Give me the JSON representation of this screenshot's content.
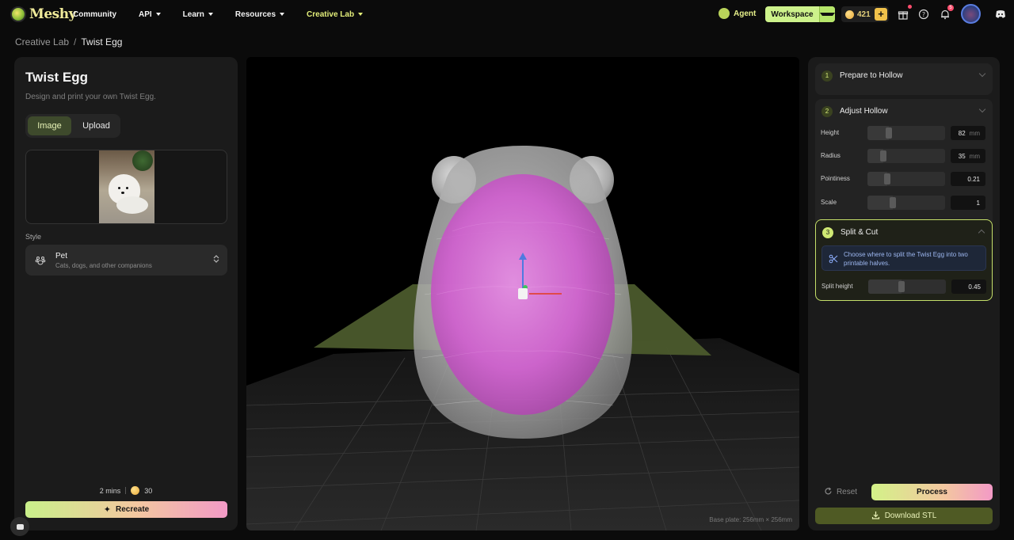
{
  "app": {
    "logo_text": "Meshy"
  },
  "nav": {
    "items": [
      {
        "label": "Community",
        "has_dropdown": false,
        "active": false
      },
      {
        "label": "API",
        "has_dropdown": true,
        "active": false
      },
      {
        "label": "Learn",
        "has_dropdown": true,
        "active": false
      },
      {
        "label": "Resources",
        "has_dropdown": true,
        "active": false
      },
      {
        "label": "Creative Lab",
        "has_dropdown": true,
        "active": true
      }
    ],
    "agent_label": "Agent",
    "workspace_label": "Workspace",
    "credits": "421",
    "notification_count": "5"
  },
  "breadcrumb": {
    "parent": "Creative Lab",
    "separator": "/",
    "current": "Twist Egg"
  },
  "left_panel": {
    "title": "Twist Egg",
    "subtitle": "Design and print your own Twist Egg.",
    "tabs": [
      {
        "label": "Image",
        "active": true
      },
      {
        "label": "Upload",
        "active": false
      }
    ],
    "style_label": "Style",
    "style_value": "Pet",
    "style_description": "Cats, dogs, and other companions",
    "time_estimate": "2 mins",
    "cost": "30",
    "recreate_label": "Recreate"
  },
  "viewport": {
    "plate_note": "Base plate: 256mm × 256mm"
  },
  "right_panel": {
    "steps": [
      {
        "number": "1",
        "title": "Prepare to Hollow"
      },
      {
        "number": "2",
        "title": "Adjust Hollow"
      },
      {
        "number": "3",
        "title": "Split & Cut"
      }
    ],
    "hollow_params": [
      {
        "label": "Height",
        "value": "82",
        "unit": "mm",
        "fraction": 0.28
      },
      {
        "label": "Radius",
        "value": "35",
        "unit": "mm",
        "fraction": 0.2
      },
      {
        "label": "Pointiness",
        "value": "0.21",
        "unit": "",
        "fraction": 0.25
      },
      {
        "label": "Scale",
        "value": "1",
        "unit": "",
        "fraction": 0.33
      }
    ],
    "split_info": "Choose where to split the Twist Egg into two printable halves.",
    "split_param": {
      "label": "Split height",
      "value": "0.45",
      "fraction": 0.43
    },
    "reset_label": "Reset",
    "process_label": "Process",
    "download_label": "Download STL"
  },
  "colors": {
    "accent_green": "#cdf28b",
    "accent_pink": "#f39ac6",
    "active_nav": "#e3ee7a",
    "egg_pink": "#d25ad2"
  }
}
